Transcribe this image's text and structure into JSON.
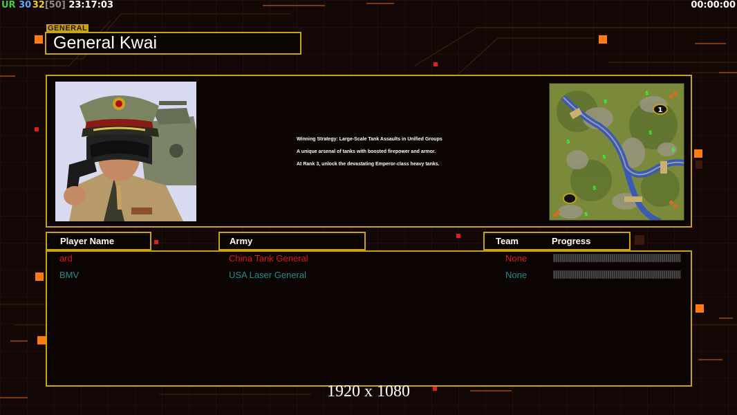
{
  "hud": {
    "left": [
      {
        "text": "UR",
        "color": "#3fcf3f"
      },
      {
        "text": "30",
        "color": "#5aa7ff"
      },
      {
        "text": "32",
        "color": "#f0d020"
      },
      {
        "text": "[50]",
        "color": "#8a8a8a"
      },
      {
        "text": "23:17:03",
        "color": "#ffffff"
      }
    ],
    "right_timer": "00:00:00"
  },
  "general": {
    "tag": "GENERAL",
    "name": "General Kwai"
  },
  "description": {
    "lines": [
      "Winning Strategy: Large-Scale Tank Assaults in Unified Groups",
      "A unique arsenal of tanks with boosted firepower and armor.",
      "At Rank 3, unlock the devastating Emperor-class heavy tanks."
    ]
  },
  "minimap": {
    "start_marker": "1"
  },
  "table": {
    "headers": {
      "player": "Player Name",
      "army": "Army",
      "team": "Team",
      "progress": "Progress"
    },
    "rows": [
      {
        "player": "ard",
        "army": "China Tank General",
        "team": "None",
        "color": "#e01818",
        "progress": 0
      },
      {
        "player": "BMV",
        "army": "USA Laser General",
        "team": "None",
        "color": "#1f8f8f",
        "progress": 0
      }
    ]
  },
  "resolution": "1920 x 1080",
  "colors": {
    "frame": "#c9a316",
    "background": "#140807",
    "accent_orange": "#ff7a10"
  }
}
